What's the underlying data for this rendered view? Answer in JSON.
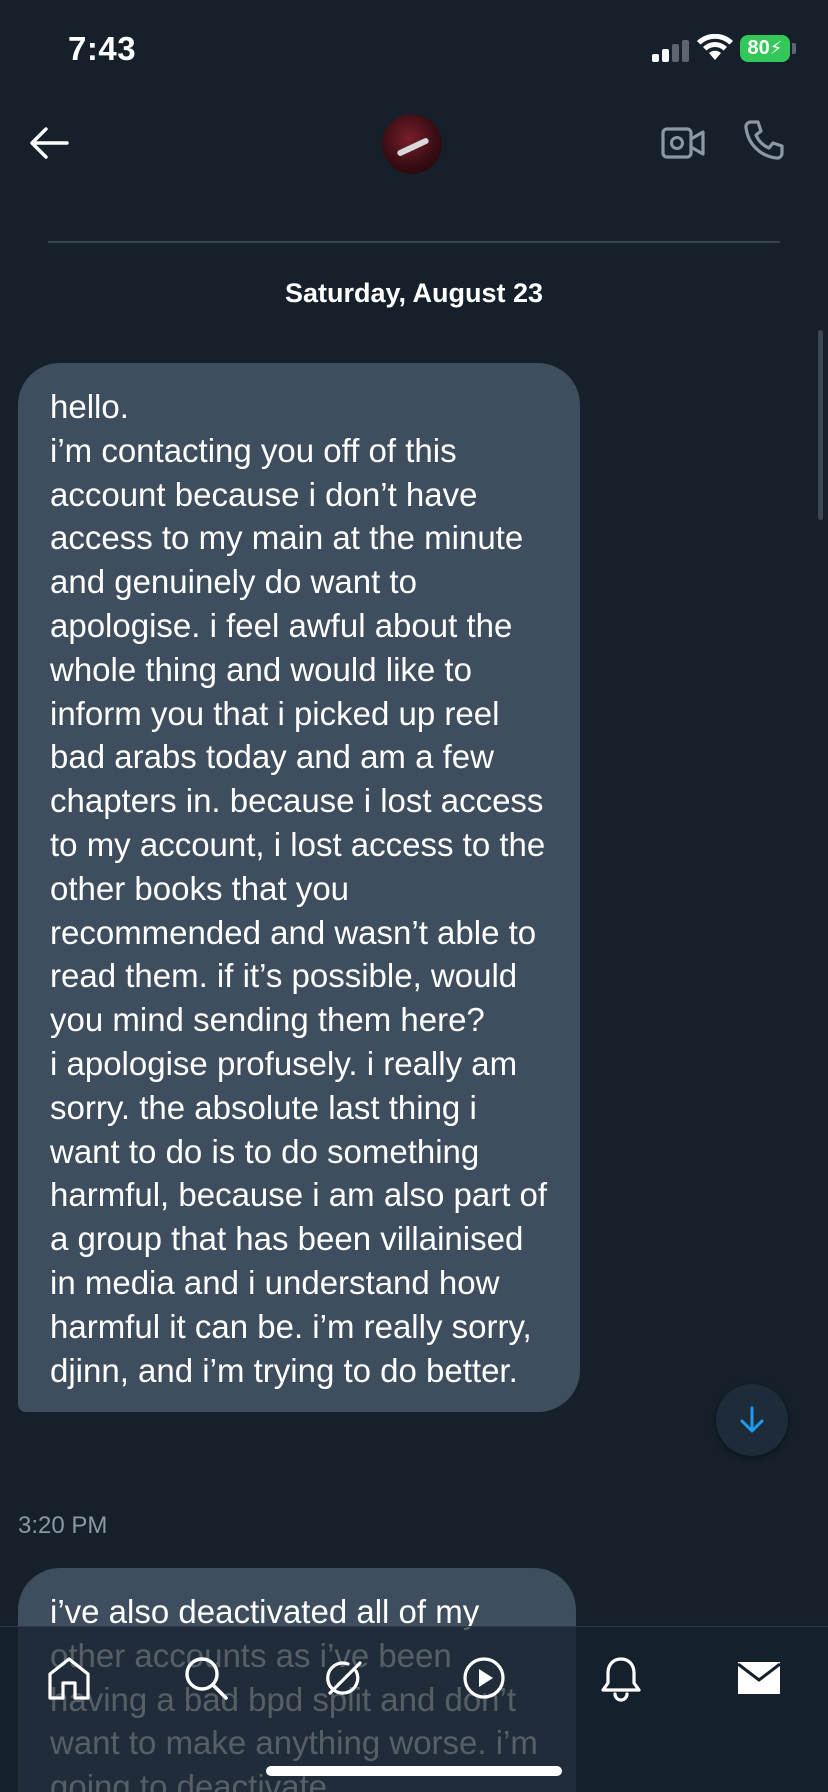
{
  "status_bar": {
    "time": "7:43",
    "battery": "80"
  },
  "conversation": {
    "date_separator": "Saturday, August 23",
    "messages": [
      {
        "text": "hello.\ni’m contacting you off of this account because i don’t have access to my main at the minute and genuinely do want to apologise. i feel awful about the whole thing and would like to inform you that i picked up reel bad arabs today and am a few chapters in. because i lost access to my account, i lost access to the other books that you recommended and wasn’t able to read them. if it’s possible, would you mind sending them here?\ni apologise profusely. i really am sorry. the absolute last thing i want to do is to do something harmful, because i am also part of a group that has been villainised in media and i understand how harmful it can be. i’m really sorry, djinn, and i’m trying to do better.",
        "time": "3:20 PM"
      },
      {
        "text": "i’ve also deactivated all of my other accounts as i’ve been having a bad bpd split and don’t want to make anything worse. i’m going to deactivate"
      }
    ]
  },
  "icons": {
    "back": "arrow-left-icon",
    "video": "video-camera-icon",
    "phone": "phone-icon",
    "scroll_down": "arrow-down-icon",
    "nav": [
      "home-icon",
      "search-icon",
      "grok-icon",
      "play-icon",
      "bell-icon",
      "mail-icon"
    ]
  },
  "colors": {
    "background": "#15202b",
    "bubble": "#3e4e5e",
    "accent": "#1d9bf0",
    "battery": "#34c759",
    "muted_text": "#8b98a5"
  }
}
